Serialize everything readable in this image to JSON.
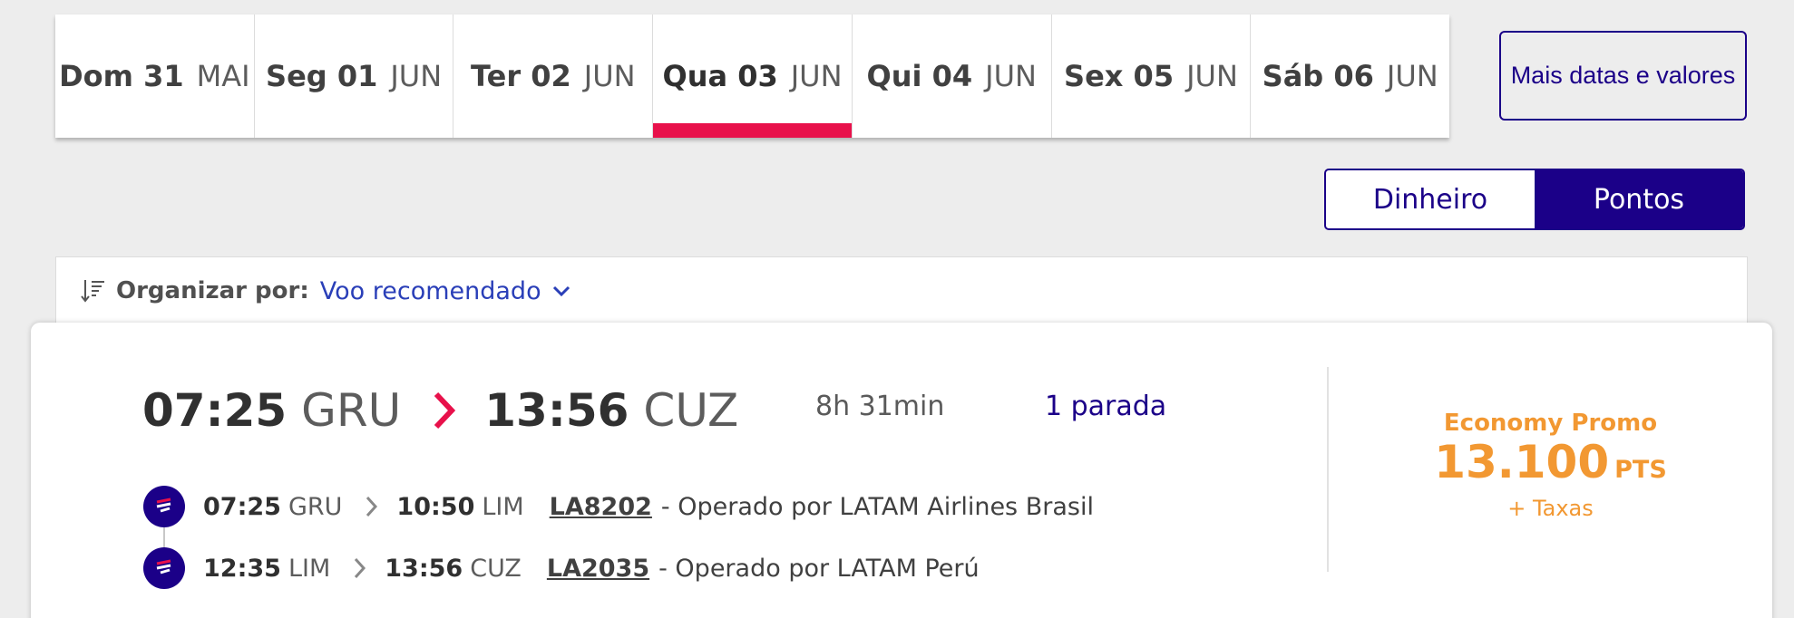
{
  "date_tabs": [
    {
      "day": "Dom 31",
      "month": "MAI",
      "selected": false
    },
    {
      "day": "Seg 01",
      "month": "JUN",
      "selected": false
    },
    {
      "day": "Ter 02",
      "month": "JUN",
      "selected": false
    },
    {
      "day": "Qua 03",
      "month": "JUN",
      "selected": true
    },
    {
      "day": "Qui 04",
      "month": "JUN",
      "selected": false
    },
    {
      "day": "Sex 05",
      "month": "JUN",
      "selected": false
    },
    {
      "day": "Sáb 06",
      "month": "JUN",
      "selected": false
    }
  ],
  "more_dates_label": "Mais datas e valores",
  "currency_toggle": {
    "money": "Dinheiro",
    "points": "Pontos",
    "active": "points"
  },
  "sort": {
    "label": "Organizar por:",
    "value": "Voo recomendado"
  },
  "flight": {
    "departure_time": "07:25",
    "departure_code": "GRU",
    "arrival_time": "13:56",
    "arrival_code": "CUZ",
    "duration": "8h 31min",
    "stops": "1 parada",
    "segments": [
      {
        "dep_time": "07:25",
        "dep_code": "GRU",
        "arr_time": "10:50",
        "arr_code": "LIM",
        "flight_number": "LA8202",
        "operator": "- Operado por LATAM Airlines Brasil"
      },
      {
        "dep_time": "12:35",
        "dep_code": "LIM",
        "arr_time": "13:56",
        "arr_code": "CUZ",
        "flight_number": "LA2035",
        "operator": "- Operado por LATAM Perú"
      }
    ],
    "fare": {
      "class": "Economy Promo",
      "price": "13.100",
      "unit": "PTS",
      "fees": "+ Taxas"
    }
  },
  "colors": {
    "brand": "#1b0088",
    "accent": "#e8114b",
    "fare": "#f29832",
    "link": "#2a3fb8"
  }
}
